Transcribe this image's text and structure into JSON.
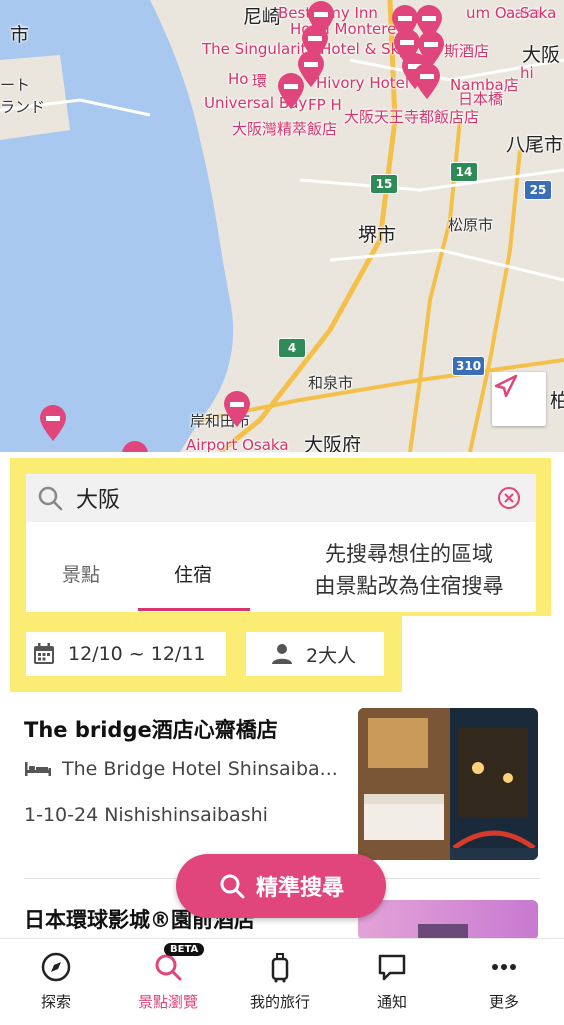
{
  "map": {
    "city_labels": [
      "尼崎",
      "市",
      "ート",
      "ランド",
      "大阪",
      "八尾市",
      "堺市",
      "松原市",
      "和泉市",
      "大阪府",
      "岸和田市",
      "柏"
    ],
    "poi_labels": [
      "Best Amy Inn",
      "um Osaka",
      "Hotel Monterey",
      "The Singularity Hotel & Sky",
      "斯酒店",
      "Ho",
      "環",
      "Hivory Hotel",
      "Namba店",
      "Universal Bay",
      "FP H",
      "日本橋",
      "大阪灣精萃飯店",
      "大阪天王寺都飯店店",
      "Airport Osaka",
      "a Saka",
      "hi"
    ],
    "route_shields": [
      "15",
      "14",
      "25",
      "4",
      "310"
    ],
    "colors": {
      "water": "#a9c8f0",
      "land": "#eae6de",
      "pin": "#e0457b",
      "road": "#f5c04a"
    }
  },
  "search": {
    "icon": "search-icon",
    "value": "大阪",
    "clear_icon": "clear-circle-icon"
  },
  "tabs": {
    "items": [
      {
        "label": "景點",
        "active": false
      },
      {
        "label": "住宿",
        "active": true
      }
    ],
    "annotation_line1": "先搜尋想住的區域",
    "annotation_line2": "由景點改為住宿搜尋"
  },
  "filters": {
    "date_icon": "calendar-icon",
    "date_range": "12/10 ~ 12/11",
    "guest_icon": "person-icon",
    "guests": "2大人"
  },
  "results": [
    {
      "name": "The bridge酒店心齋橋店",
      "english_name": "The Bridge Hotel Shinsaiba...",
      "type_icon": "bed-icon",
      "address": "1-10-24 Nishishinsaibashi"
    },
    {
      "name": "日本環球影城®園前酒店"
    }
  ],
  "fab": {
    "label": "精準搜尋",
    "icon": "search-icon"
  },
  "bottom_nav": {
    "items": [
      {
        "label": "探索",
        "icon": "compass-icon",
        "active": false
      },
      {
        "label": "景點瀏覽",
        "icon": "search-icon",
        "active": true,
        "badge": "BETA"
      },
      {
        "label": "我的旅行",
        "icon": "luggage-icon",
        "active": false
      },
      {
        "label": "通知",
        "icon": "chat-bubble-icon",
        "active": false
      },
      {
        "label": "更多",
        "icon": "more-dots-icon",
        "active": false
      }
    ]
  }
}
